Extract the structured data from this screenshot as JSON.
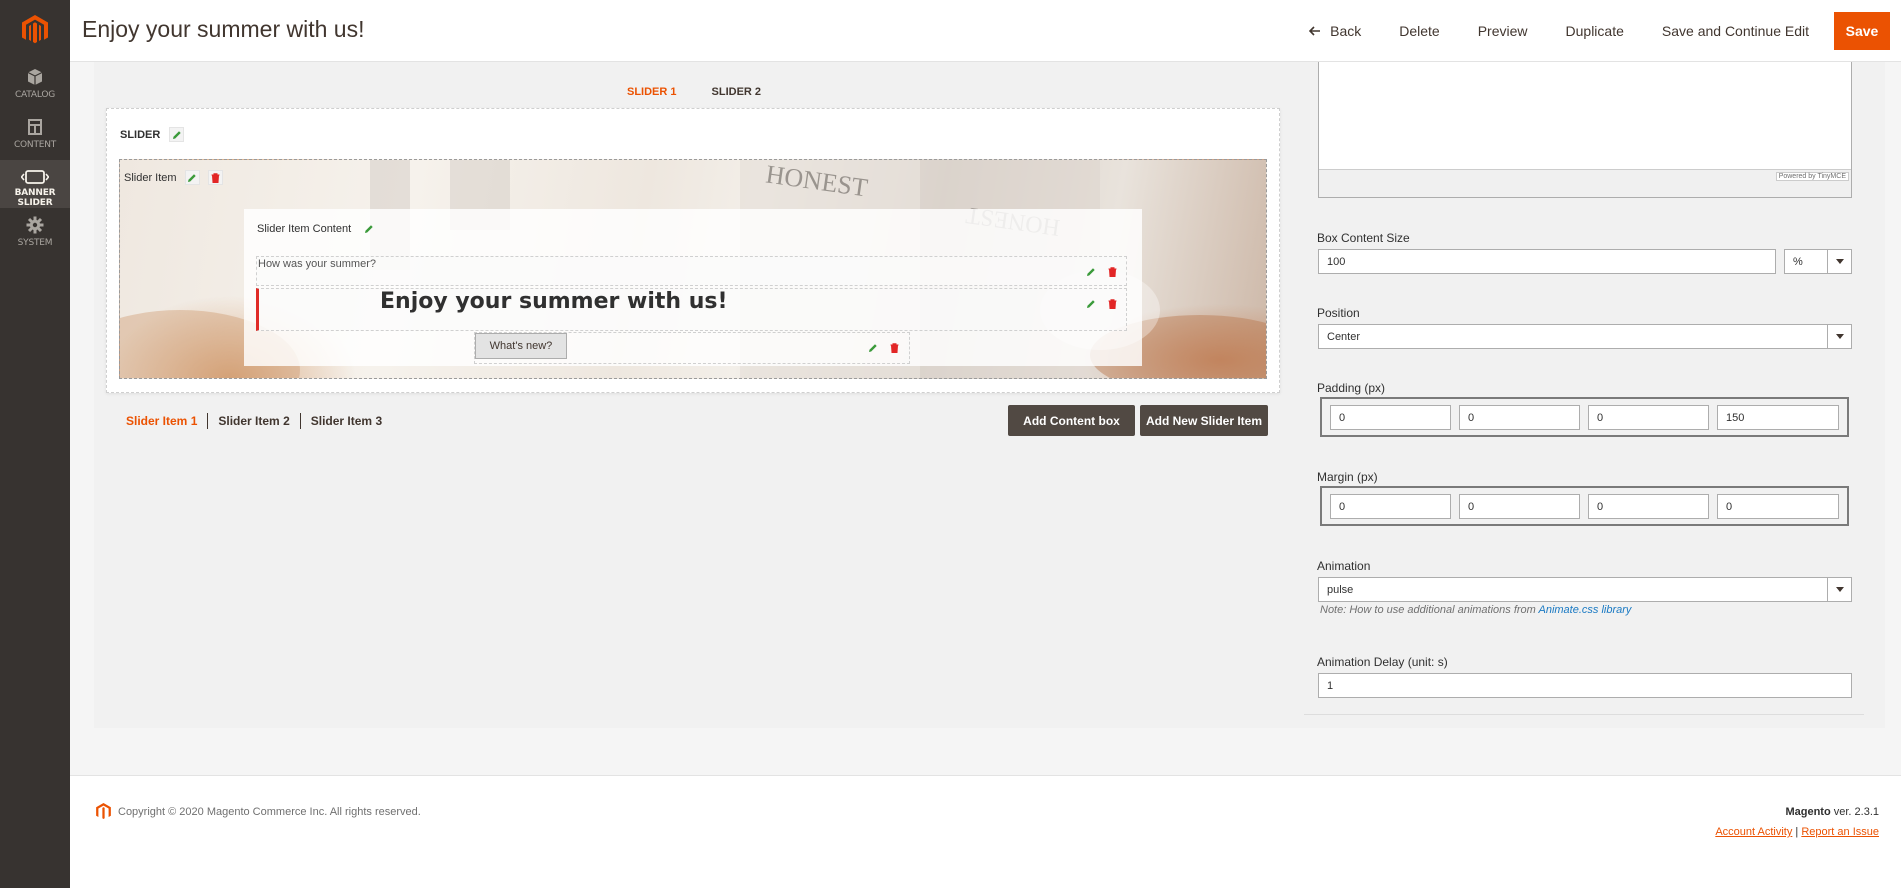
{
  "sidebar": {
    "items": [
      {
        "label": "CATALOG",
        "icon": "box-icon"
      },
      {
        "label": "CONTENT",
        "icon": "layout-icon"
      },
      {
        "label": "BANNER SLIDER",
        "icon": "slider-icon"
      },
      {
        "label": "SYSTEM",
        "icon": "gear-icon"
      }
    ]
  },
  "header": {
    "title": "Enjoy your summer with us!",
    "back": "Back",
    "delete": "Delete",
    "preview": "Preview",
    "duplicate": "Duplicate",
    "save_continue": "Save and Continue Edit",
    "save": "Save"
  },
  "slider_tabs": [
    "SLIDER 1",
    "SLIDER 2"
  ],
  "slider": {
    "label": "SLIDER",
    "item_tag": "Slider Item",
    "content_title": "Slider Item Content",
    "subtitle": "How was your summer?",
    "heading": "Enjoy your summer with us!",
    "button": "What's new?"
  },
  "item_nav": [
    "Slider Item 1",
    "Slider Item 2",
    "Slider Item 3"
  ],
  "buttons": {
    "add_content": "Add Content box",
    "add_slider_item": "Add New Slider Item"
  },
  "editor": {
    "powered": "Powered by TinyMCE"
  },
  "form": {
    "box_content_size": {
      "label": "Box Content Size",
      "value": "100",
      "unit": "%"
    },
    "position": {
      "label": "Position",
      "value": "Center"
    },
    "padding": {
      "label": "Padding (px)",
      "values": [
        "0",
        "0",
        "0",
        "150"
      ]
    },
    "margin": {
      "label": "Margin (px)",
      "values": [
        "0",
        "0",
        "0",
        "0"
      ]
    },
    "animation": {
      "label": "Animation",
      "value": "pulse",
      "note": "Note: How to use additional animations from ",
      "link": "Animate.css library"
    },
    "animation_delay": {
      "label": "Animation Delay (unit: s)",
      "value": "1"
    }
  },
  "footer": {
    "copyright": "Copyright © 2020 Magento Commerce Inc. All rights reserved.",
    "brand": "Magento",
    "version": " ver. 2.3.1",
    "account_activity": "Account Activity",
    "separator": "|",
    "report_issue": "Report an Issue"
  },
  "colors": {
    "accent": "#eb5202",
    "sidebar": "#373330",
    "dark_button": "#514943"
  }
}
